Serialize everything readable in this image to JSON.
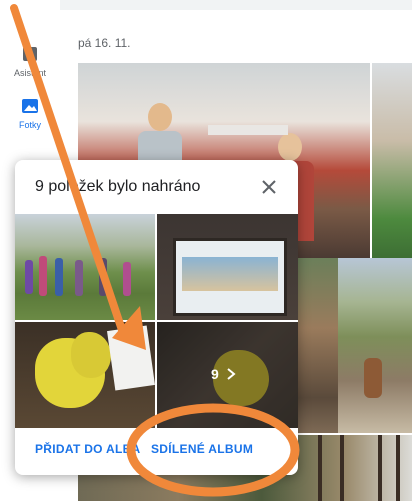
{
  "nav": {
    "items": [
      {
        "label": "Asistent",
        "icon": "assistant-icon"
      },
      {
        "label": "Fotky",
        "icon": "photos-icon",
        "active": true
      }
    ]
  },
  "section": {
    "date_label": "pá 16. 11."
  },
  "dialog": {
    "title": "9 položek bylo nahráno",
    "more_count": "9",
    "more_icon": "chevron-right-icon",
    "actions": {
      "add_to_album": "PŘIDAT DO ALBA",
      "shared_album": "SDÍLENÉ ALBUM"
    }
  },
  "colors": {
    "accent": "#1a73e8",
    "annotation": "#f0883a"
  }
}
